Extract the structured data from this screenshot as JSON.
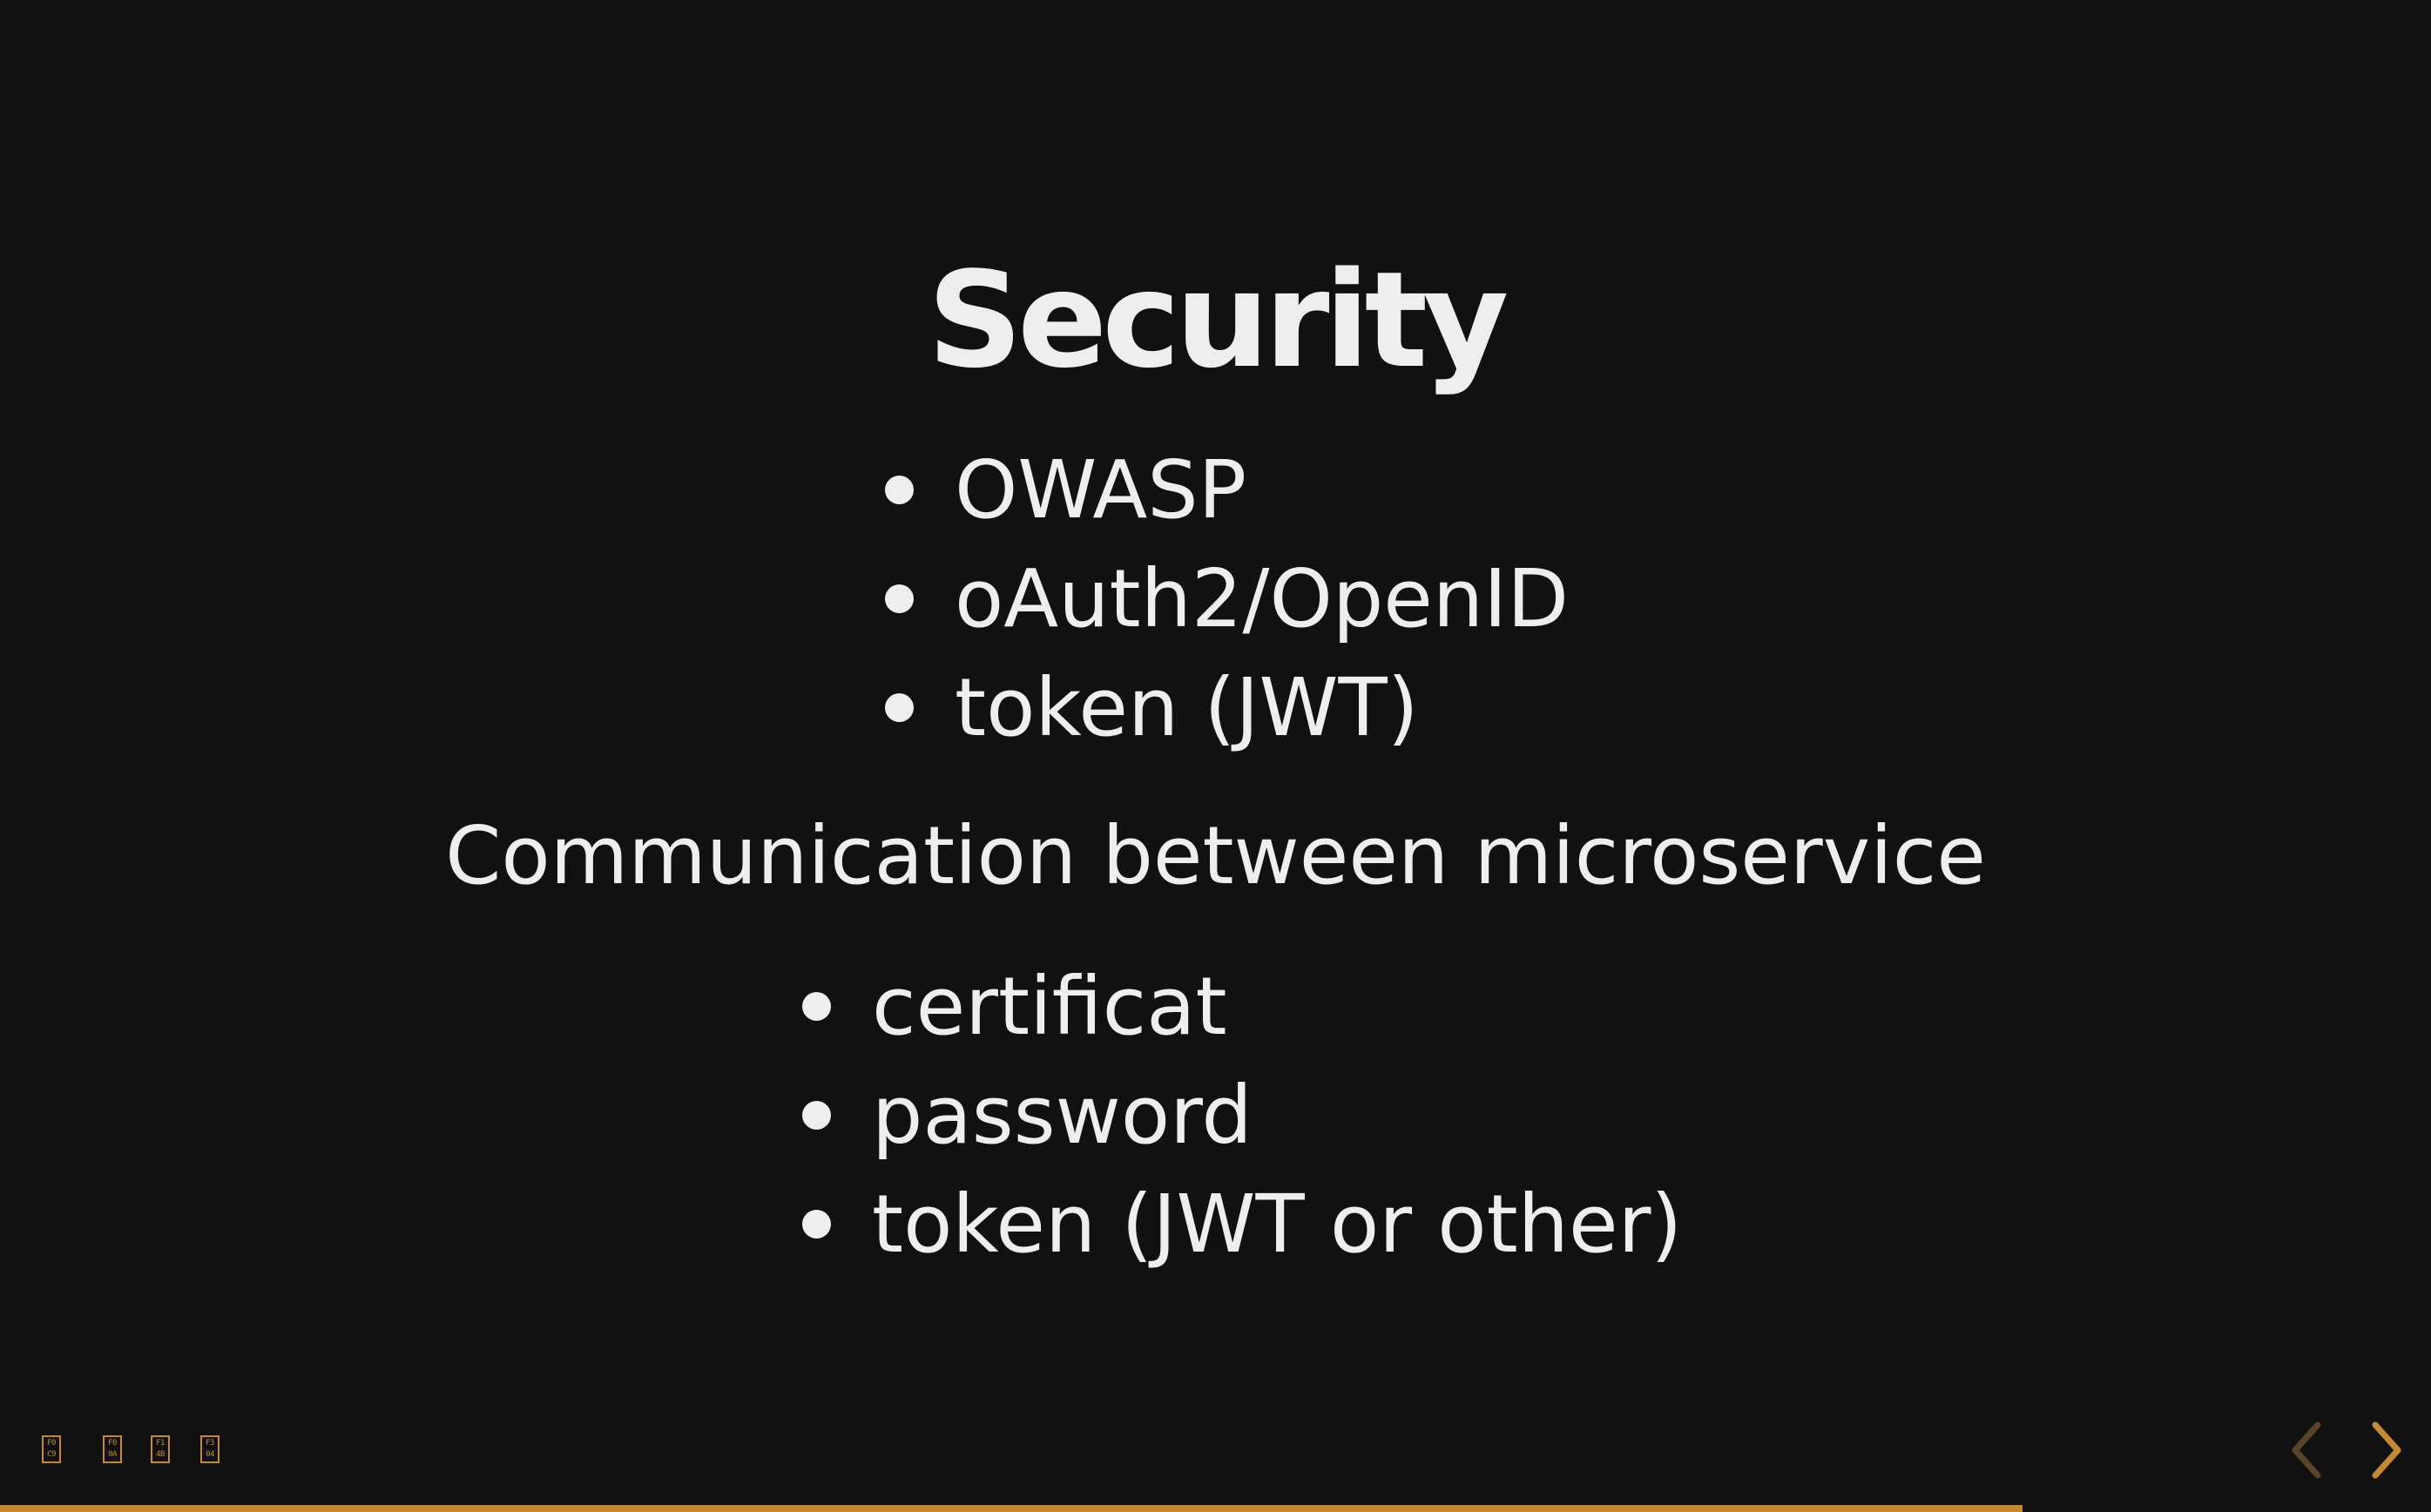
{
  "slide": {
    "title": "Security",
    "list_1": [
      "OWASP",
      "oAuth2/OpenID",
      "token (JWT)"
    ],
    "subtitle": "Communication between microservice",
    "list_2": [
      "certificat",
      "password",
      "token (JWT or other)"
    ]
  },
  "controls": {
    "glyphs": [
      "F0\nC9",
      "F0\n0A",
      "F1\n4B",
      "F3\n04"
    ],
    "prev_icon": "chevron-left-icon",
    "next_icon": "chevron-right-icon"
  },
  "progress": {
    "fraction": 0.832
  },
  "colors": {
    "background": "#111111",
    "text": "#eeeeee",
    "accent": "#c58a2e"
  }
}
